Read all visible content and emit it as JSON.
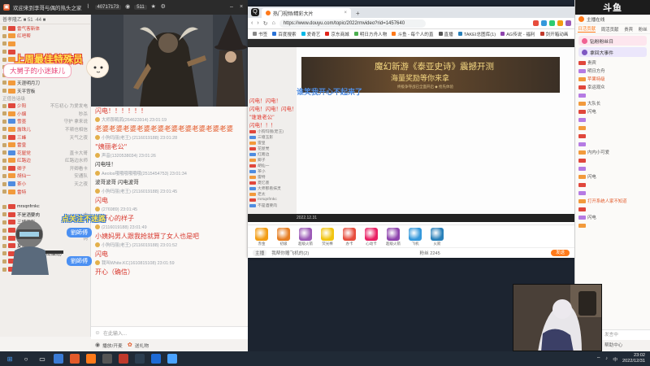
{
  "left_window": {
    "title": "欢迎来到李哥与偶的热头之家",
    "stats": [
      "40717173",
      "511"
    ],
    "sidebar_header": "普孝隆乙 ■ 51 ·44 ■",
    "sidebar_rows": [
      {
        "lv": "",
        "name": "雷气客新体",
        "cls": "hot"
      },
      {
        "lv": "",
        "name": "红吧帮",
        "cls": "hot"
      },
      {
        "lv": "",
        "name": "",
        "cls": ""
      },
      {
        "lv": "",
        "name": "",
        "cls": ""
      },
      {
        "lv": "",
        "name": "",
        "cls": ""
      },
      {
        "lv": "",
        "name": "",
        "cls": ""
      },
      {
        "lv": "",
        "name": "",
        "cls": ""
      },
      {
        "lv": "",
        "name": "天涯明月刀",
        "cls": ""
      },
      {
        "lv": "",
        "name": "天平宫板",
        "cls": ""
      }
    ],
    "section_label": "正值告话级",
    "sidebar_rows2": [
      {
        "name": "少阳",
        "tag": "不忘初心 为爱发电"
      },
      {
        "name": "小烟",
        "tag": "秒杀"
      },
      {
        "name": "雪墨",
        "tag": "守护 拿来说"
      },
      {
        "name": "露珠儿",
        "tag": "不顿也相信"
      },
      {
        "name": "三峰",
        "tag": "天气之夜"
      },
      {
        "name": "雷皇",
        "tag": ""
      },
      {
        "name": "花屋党",
        "tag": "直卡大哥"
      },
      {
        "name": "红路边",
        "tag": "红路边水师"
      },
      {
        "name": "卿子",
        "tag": "开卿看卡"
      },
      {
        "name": "胡仙一",
        "tag": "安通队"
      },
      {
        "name": "茶小",
        "tag": "天之夜"
      },
      {
        "name": "雷特",
        "tag": ""
      }
    ],
    "sidebar_rows3": [
      {
        "name": "mrsqnfrnkc",
        "tag": ""
      },
      {
        "name": "不是酒要肉",
        "tag": "大"
      },
      {
        "name": "三塘玉影",
        "tag": ""
      },
      {
        "name": "黄西",
        "tag": ""
      },
      {
        "name": "胡白的aa E",
        "tag": "钩"
      },
      {
        "name": "夏忆墨",
        "tag": ""
      },
      {
        "name": "夜梦光leak (千山烟雨)",
        "tag": ""
      },
      {
        "name": "大师那看抹灵",
        "tag": ""
      },
      {
        "name": "老太",
        "tag": ""
      }
    ],
    "chat": [
      {
        "meta": "",
        "text": "闪电！！！！！！",
        "style": "red"
      },
      {
        "meta": "大师那鹌鹑(264623914) 23:01:19",
        "text": "",
        "style": ""
      },
      {
        "meta": "",
        "text": "老婆老婆老婆老婆老婆老婆老婆老婆老婆老婆",
        "style": "big"
      },
      {
        "meta": "小狗玛丽(老王) (2116019188) 23:01:28",
        "text": "",
        "style": ""
      },
      {
        "meta": "",
        "text": "\"姨丽老公\"",
        "style": "red"
      },
      {
        "meta": "声音(1320538034) 23:01:26",
        "text": "",
        "style": ""
      },
      {
        "meta": "",
        "text": "闪电哇！",
        "style": "normal"
      },
      {
        "meta": "Aeolos哦哦哦哦哦哦(2515454753) 23:01:34",
        "text": "",
        "style": ""
      },
      {
        "meta": "",
        "text": "波哥波哥 闪电波哥",
        "style": "normal"
      },
      {
        "meta": "小狗玛丽(老王) (2116019188) 23:01:45",
        "text": "",
        "style": ""
      },
      {
        "meta": "",
        "text": "闪电",
        "style": "red"
      },
      {
        "meta": "(276989) 23:01:45",
        "text": "",
        "style": ""
      },
      {
        "meta": "",
        "text": "不开心的样子",
        "style": "red"
      },
      {
        "meta": "(2116019188) 23:01:49",
        "text": "",
        "style": ""
      },
      {
        "meta": "",
        "text": "小姨妈男人跟我抢就算了女人也是吧",
        "style": "red"
      },
      {
        "meta": "小狗玛丽(老王) (2116019188) 23:01:52",
        "text": "",
        "style": ""
      },
      {
        "meta": "",
        "text": "闪电",
        "style": "red"
      },
      {
        "meta": "我叫White.KC(1610815108) 23:01:59",
        "text": "",
        "style": ""
      },
      {
        "meta": "",
        "text": "开心（确信）",
        "style": "red"
      }
    ],
    "input_placeholder": "在此输入...",
    "bottom_bar": {
      "broadcast": "播放/开麦",
      "gift": "送礼物"
    },
    "stickers": {
      "title": "上周最佳特殊员",
      "fan": "大舅子的小迷妹儿",
      "follow": "点关注不迷路",
      "name_a": "劉師傅",
      "name_b": "劉師傅"
    }
  },
  "browser": {
    "tab_title": "热门视频/精彩大片",
    "url": "https://www.douyu.com/topic/2022rmvideo?rid=1457640",
    "bookmarks": [
      "书签",
      "百度搜索",
      "爱奇艺",
      "京东商城",
      "明日方舟人物",
      "斗鱼 - 每个人的直",
      "直播",
      "TAKEI总图库(1)",
      "AG传说 - 福利",
      "剑开箱动画"
    ],
    "banner_title": "魔幻新游《泰亚史诗》震撼开测",
    "banner_sub": "海量奖励等你来拿",
    "banner_small": "终极争夺战已全面开启 ◆ 抢先体验",
    "nested_sticker": "谁笑我开心不起来了",
    "nested_hl": [
      "闪电！闪电！",
      "闪电！闪电！闪电！",
      "\"谁谁老公\"",
      "闪电！！！"
    ],
    "nested_lines": [
      "小狗玛丽(老王)",
      "三塘玉影",
      "雷皇",
      "花屋党",
      "红路边",
      "卿子",
      "胡仙一",
      "茶小",
      "雷特",
      "夏忆墨",
      "大师那看抹灵",
      "老太",
      "mrsqnfrnkc",
      "不是酒要肉"
    ],
    "gift_labels": [
      "赤金",
      "初级",
      "超级火箭",
      "荧光棒",
      "办卡",
      "心动卡",
      "超级火箭",
      "飞机",
      "火箭"
    ],
    "info": {
      "tag": "主播",
      "text": "我帮你赠飞机的(2)",
      "count": "粉丝 2245",
      "send": "发送"
    },
    "inner_time": "2022.12.31",
    "video_caption": "谁谁老公"
  },
  "right_panel": {
    "logo": "斗鱼",
    "header": "主播在线",
    "tabs": [
      "日活贡献",
      "周活贡献",
      "贵宾",
      "粉丝"
    ],
    "cards": [
      {
        "text": "钻粉粉丝日",
        "color": "pink"
      },
      {
        "text": "拿回大事件",
        "color": "lav"
      }
    ],
    "rows": [
      "贵宾",
      "明日方舟",
      "苹果特级",
      "幸运观众",
      "",
      "大队长",
      "闪电",
      "",
      "",
      "",
      "",
      "内内小可爱",
      "",
      "",
      "闪电",
      "",
      "",
      "打开系统人家不知道",
      "",
      "闪电",
      ""
    ],
    "input_placeholder": "发言中",
    "bottom": "帮助中心"
  },
  "taskbar": {
    "time": "23:02",
    "date": "2022/12/31",
    "tray": "中"
  }
}
